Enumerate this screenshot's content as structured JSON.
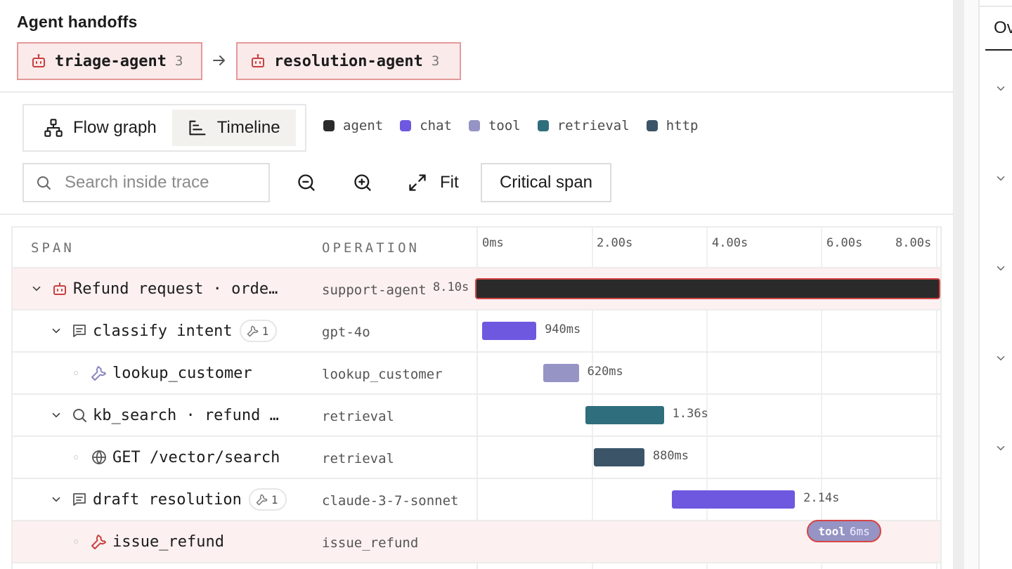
{
  "header": {
    "title": "Agent handoffs"
  },
  "handoffs": [
    {
      "name": "triage-agent",
      "count": "3"
    },
    {
      "name": "resolution-agent",
      "count": "3"
    }
  ],
  "view_toggle": {
    "flow_graph": "Flow graph",
    "timeline": "Timeline",
    "active": "timeline"
  },
  "legend": [
    {
      "label": "agent",
      "color": "#2a2a2a"
    },
    {
      "label": "chat",
      "color": "#6f58e0"
    },
    {
      "label": "tool",
      "color": "#9693c5"
    },
    {
      "label": "retrieval",
      "color": "#2f6e7d"
    },
    {
      "label": "http",
      "color": "#3b5468"
    }
  ],
  "toolbar": {
    "search_placeholder": "Search inside trace",
    "fit_label": "Fit",
    "critical_label": "Critical span"
  },
  "table": {
    "col_span": "SPAN",
    "col_operation": "OPERATION",
    "ticks": [
      "0ms",
      "2.00s",
      "4.00s",
      "6.00s",
      "8.00s"
    ],
    "rows": [
      {
        "name": "Refund request · orde…",
        "operation": "support-agent",
        "duration": "8.10s",
        "type": "agent",
        "icon": "robot-icon",
        "expanded": true,
        "depth": 0,
        "highlight": true,
        "start_s": 0.0,
        "duration_s": 8.1
      },
      {
        "name": "classify intent",
        "operation": "gpt-4o",
        "duration": "940ms",
        "type": "chat",
        "icon": "chat-icon",
        "expanded": true,
        "depth": 1,
        "badge": "1",
        "start_s": 0.1,
        "duration_s": 0.94
      },
      {
        "name": "lookup_customer",
        "operation": "lookup_customer",
        "duration": "620ms",
        "type": "tool",
        "icon": "wrench-icon",
        "leaf": true,
        "depth": 2,
        "start_s": 1.16,
        "duration_s": 0.62
      },
      {
        "name": "kb_search · refund …",
        "operation": "retrieval",
        "duration": "1.36s",
        "type": "retrieval",
        "icon": "search-icon",
        "expanded": true,
        "depth": 1,
        "start_s": 1.9,
        "duration_s": 1.36
      },
      {
        "name": "GET /vector/search",
        "operation": "retrieval",
        "duration": "880ms",
        "type": "http",
        "icon": "globe-icon",
        "leaf": true,
        "depth": 2,
        "start_s": 2.04,
        "duration_s": 0.88
      },
      {
        "name": "draft resolution",
        "operation": "claude-3-7-sonnet",
        "duration": "2.14s",
        "type": "chat",
        "icon": "chat-icon",
        "expanded": true,
        "depth": 1,
        "badge": "1",
        "start_s": 3.4,
        "duration_s": 2.14
      },
      {
        "name": "issue_refund",
        "operation": "issue_refund",
        "duration": "6ms",
        "type": "tool",
        "icon": "wrench-icon",
        "leaf": true,
        "depth": 2,
        "highlight": true,
        "error": true,
        "pill_type": "tool",
        "start_s": 5.6,
        "duration_s": 0.006
      }
    ]
  },
  "right_panel": {
    "tab_label": "Ov"
  }
}
